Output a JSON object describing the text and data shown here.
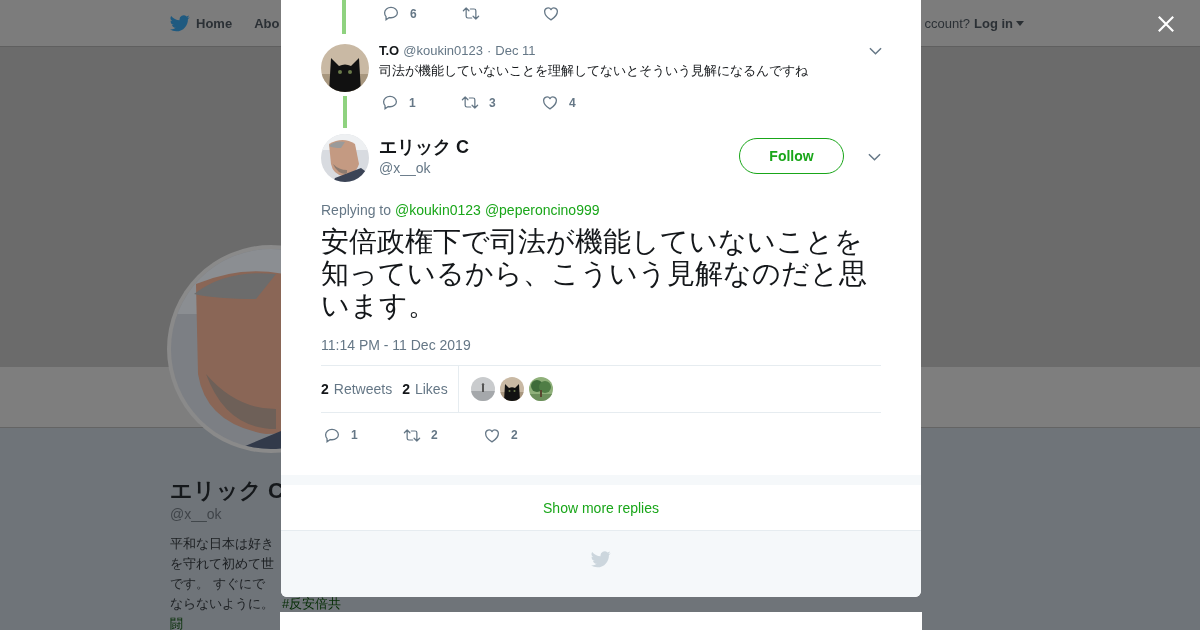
{
  "page": {
    "nav": {
      "items": [
        {
          "kind": "home",
          "label": "Home"
        },
        {
          "kind": "link",
          "label": "Abo"
        }
      ],
      "account_prompt": "ccount?",
      "login": "Log in"
    },
    "profile": {
      "avatar": {
        "kind": "picture"
      },
      "name": "エリック C",
      "handle": "@x__ok",
      "bio_lines": [
        [
          {
            "kind": "text",
            "text": "平和な日本は好き"
          }
        ],
        [
          {
            "kind": "text",
            "text": "を守れて初めて世"
          }
        ],
        [
          {
            "kind": "text",
            "text": "です。 すぐにで"
          }
        ],
        [
          {
            "kind": "text",
            "text": "ならないように。"
          },
          {
            "kind": "hashtag",
            "text": "#反安倍共"
          }
        ],
        [
          {
            "kind": "hashtag",
            "text": "闘"
          }
        ]
      ]
    }
  },
  "modal": {
    "thread": [
      {
        "kind": "partial",
        "actions": [
          {
            "kind": "reply",
            "count": "6"
          },
          {
            "kind": "retweet"
          },
          {
            "kind": "like"
          }
        ]
      },
      {
        "kind": "reply",
        "avatar": {
          "kind": "picture"
        },
        "name": "T.O",
        "handle": "@koukin0123",
        "separator": "·",
        "date": "Dec 11",
        "text": "司法が機能していないことを理解してないとそういう見解になるんですね",
        "actions": [
          {
            "kind": "reply",
            "count": "1"
          },
          {
            "kind": "retweet",
            "count": "3"
          },
          {
            "kind": "like",
            "count": "4"
          }
        ]
      }
    ],
    "tweet": {
      "avatar": {
        "kind": "picture"
      },
      "name": "エリック C",
      "handle": "@x__ok",
      "follow": "Follow",
      "replying_label": "Replying to",
      "mentions": [
        "@koukin0123",
        "@peperoncino999"
      ],
      "text": "安倍政権下で司法が機能していないことを知っているから、こういう見解なのだと思います。",
      "timestamp": "11:14 PM - 11 Dec 2019",
      "stats": [
        {
          "count": "2",
          "label": "Retweets"
        },
        {
          "count": "2",
          "label": "Likes"
        }
      ],
      "likers": [
        {
          "kind": "picture"
        },
        {
          "kind": "picture"
        },
        {
          "kind": "picture"
        }
      ],
      "actions": [
        {
          "kind": "reply",
          "count": "1"
        },
        {
          "kind": "retweet",
          "count": "2"
        },
        {
          "kind": "like",
          "count": "2"
        }
      ]
    },
    "show_more": "Show more replies"
  }
}
